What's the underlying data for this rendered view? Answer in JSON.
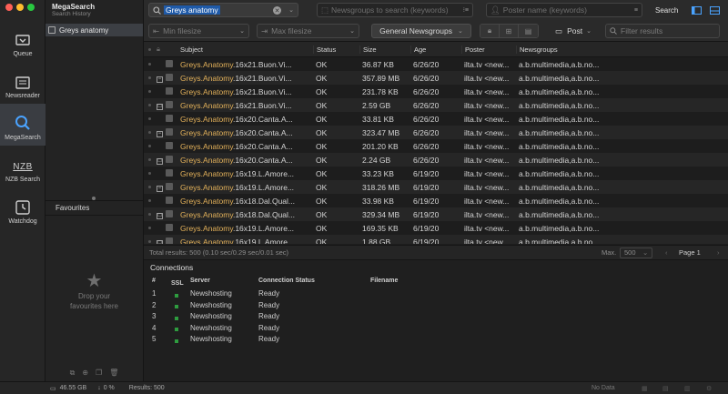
{
  "app": {
    "title": "MegaSearch",
    "subtitle": "Search History"
  },
  "rail": [
    {
      "label": "Queue",
      "icon": "queue-icon"
    },
    {
      "label": "Newsreader",
      "icon": "newsreader-icon"
    },
    {
      "label": "MegaSearch",
      "icon": "megasearch-icon"
    },
    {
      "label": "NZB Search",
      "icon": "nzb-icon",
      "glyph": "NZB"
    },
    {
      "label": "Watchdog",
      "icon": "watchdog-icon"
    }
  ],
  "history": [
    {
      "label": "Greys anatomy"
    }
  ],
  "favourites": {
    "title": "Favourites",
    "empty_line1": "Drop your",
    "empty_line2": "favourites here"
  },
  "toolbar": {
    "search_value": "Greys anatomy",
    "newsgroups_placeholder": "Newsgroups to search (keywords)",
    "poster_placeholder": "Poster name (keywords)",
    "search_button": "Search"
  },
  "filters": {
    "min_filesize": "Min filesize",
    "max_filesize": "Max filesize",
    "newsgroups_select": "General Newsgroups",
    "post_button": "Post",
    "filter_placeholder": "Filter results"
  },
  "table": {
    "columns": [
      "Subject",
      "Status",
      "Size",
      "Age",
      "Poster",
      "Newsgroups"
    ],
    "rows": [
      {
        "exp": "",
        "hl": "Greys.Anatomy",
        "rest": ".16x21.Buon.Vi...",
        "status": "OK",
        "size": "36.87 KB",
        "age": "6/26/20",
        "poster": "ilta.tv <new...",
        "ng": "a.b.multimedia,a.b.no..."
      },
      {
        "exp": "−",
        "hl": "Greys.Anatomy",
        "rest": ".16x21.Buon.Vi...",
        "status": "OK",
        "size": "357.89 MB",
        "age": "6/26/20",
        "poster": "ilta.tv <new...",
        "ng": "a.b.multimedia,a.b.no..."
      },
      {
        "exp": "",
        "hl": "Greys.Anatomy",
        "rest": ".16x21.Buon.Vi...",
        "status": "OK",
        "size": "231.78 KB",
        "age": "6/26/20",
        "poster": "ilta.tv <new...",
        "ng": "a.b.multimedia,a.b.no..."
      },
      {
        "exp": "□",
        "hl": "Greys.Anatomy",
        "rest": ".16x21.Buon.Vi...",
        "status": "OK",
        "size": "2.59 GB",
        "age": "6/26/20",
        "poster": "ilta.tv <new...",
        "ng": "a.b.multimedia,a.b.no..."
      },
      {
        "exp": "",
        "hl": "Greys.Anatomy",
        "rest": ".16x20.Canta.A...",
        "status": "OK",
        "size": "33.81 KB",
        "age": "6/26/20",
        "poster": "ilta.tv <new...",
        "ng": "a.b.multimedia,a.b.no..."
      },
      {
        "exp": "−",
        "hl": "Greys.Anatomy",
        "rest": ".16x20.Canta.A...",
        "status": "OK",
        "size": "323.47 MB",
        "age": "6/26/20",
        "poster": "ilta.tv <new...",
        "ng": "a.b.multimedia,a.b.no..."
      },
      {
        "exp": "",
        "hl": "Greys.Anatomy",
        "rest": ".16x20.Canta.A...",
        "status": "OK",
        "size": "201.20 KB",
        "age": "6/26/20",
        "poster": "ilta.tv <new...",
        "ng": "a.b.multimedia,a.b.no..."
      },
      {
        "exp": "□",
        "hl": "Greys.Anatomy",
        "rest": ".16x20.Canta.A...",
        "status": "OK",
        "size": "2.24 GB",
        "age": "6/26/20",
        "poster": "ilta.tv <new...",
        "ng": "a.b.multimedia,a.b.no..."
      },
      {
        "exp": "",
        "hl": "Greys.Anatomy",
        "rest": ".16x19.L.Amore...",
        "status": "OK",
        "size": "33.23 KB",
        "age": "6/19/20",
        "poster": "ilta.tv <new...",
        "ng": "a.b.multimedia,a.b.no..."
      },
      {
        "exp": "−",
        "hl": "Greys.Anatomy",
        "rest": ".16x19.L.Amore...",
        "status": "OK",
        "size": "318.26 MB",
        "age": "6/19/20",
        "poster": "ilta.tv <new...",
        "ng": "a.b.multimedia,a.b.no..."
      },
      {
        "exp": "",
        "hl": "Greys.Anatomy",
        "rest": ".16x18.Dal.Qual...",
        "status": "OK",
        "size": "33.98 KB",
        "age": "6/19/20",
        "poster": "ilta.tv <new...",
        "ng": "a.b.multimedia,a.b.no..."
      },
      {
        "exp": "□",
        "hl": "Greys.Anatomy",
        "rest": ".16x18.Dal.Qual...",
        "status": "OK",
        "size": "329.34 MB",
        "age": "6/19/20",
        "poster": "ilta.tv <new...",
        "ng": "a.b.multimedia,a.b.no..."
      },
      {
        "exp": "",
        "hl": "Greys.Anatomy",
        "rest": ".16x19.L.Amore...",
        "status": "OK",
        "size": "169.35 KB",
        "age": "6/19/20",
        "poster": "ilta.tv <new...",
        "ng": "a.b.multimedia,a.b.no..."
      },
      {
        "exp": "□",
        "hl": "Greys.Anatomy",
        "rest": ".16x19.L.Amore...",
        "status": "OK",
        "size": "1.88 GB",
        "age": "6/19/20",
        "poster": "ilta.tv <new...",
        "ng": "a.b.multimedia,a.b.no..."
      }
    ]
  },
  "status": {
    "total": "Total results: 500 (0.10 sec/0.29 sec/0.01 sec)",
    "max_label": "Max.",
    "max_value": "500",
    "page": "Page 1"
  },
  "connections": {
    "title": "Connections",
    "columns": [
      "#",
      "SSL",
      "Server",
      "Connection Status",
      "Filename"
    ],
    "rows": [
      {
        "n": "1",
        "server": "Newshosting",
        "status": "Ready"
      },
      {
        "n": "2",
        "server": "Newshosting",
        "status": "Ready"
      },
      {
        "n": "3",
        "server": "Newshosting",
        "status": "Ready"
      },
      {
        "n": "4",
        "server": "Newshosting",
        "status": "Ready"
      },
      {
        "n": "5",
        "server": "Newshosting",
        "status": "Ready"
      }
    ]
  },
  "bottom": {
    "disk": "46.55 GB",
    "percent": "0 %",
    "results": "Results: 500",
    "no_data": "No Data"
  },
  "colors": {
    "highlight": "#e3b15a",
    "accent": "#1f5aa8",
    "ssl_green": "#2e9c3f"
  }
}
